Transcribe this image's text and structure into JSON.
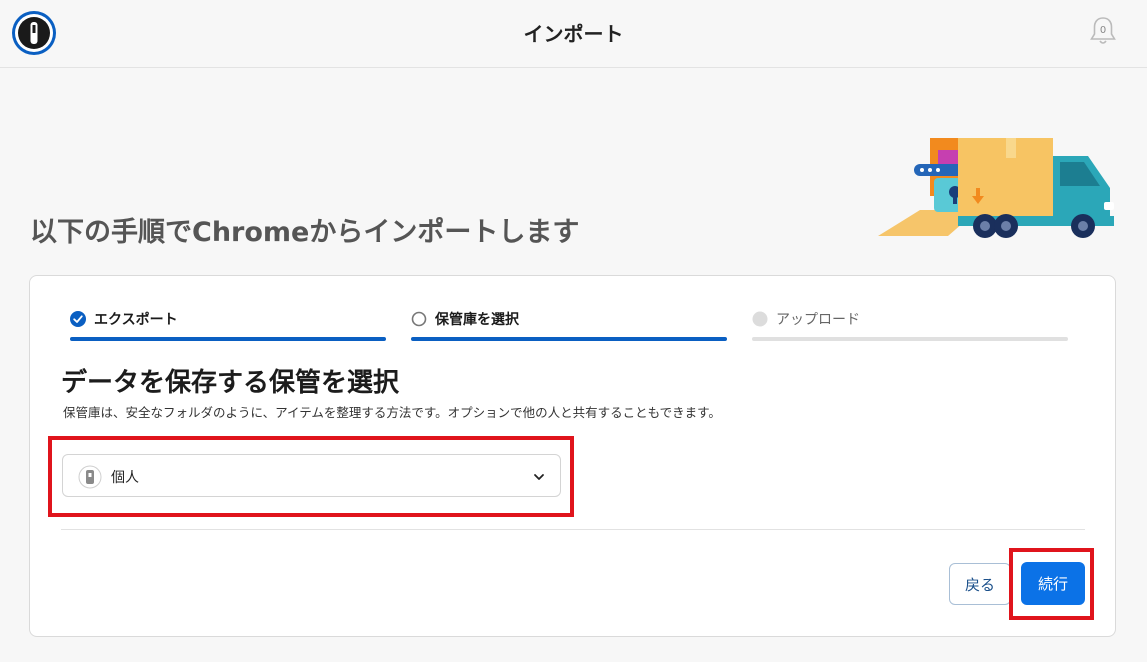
{
  "header": {
    "title": "インポート",
    "notification_count": "0"
  },
  "page": {
    "heading": "以下の手順でChromeからインポートします"
  },
  "steps": [
    {
      "label": "エクスポート",
      "state": "done"
    },
    {
      "label": "保管庫を選択",
      "state": "current"
    },
    {
      "label": "アップロード",
      "state": "upcoming"
    }
  ],
  "section": {
    "title": "データを保存する保管を選択",
    "description": "保管庫は、安全なフォルダのように、アイテムを整理する方法です。オプションで他の人と共有することもできます。"
  },
  "vault_select": {
    "selected": "個人"
  },
  "buttons": {
    "back": "戻る",
    "next": "続行"
  },
  "colors": {
    "accent": "#0b72e7",
    "step_active": "#0a5fc2",
    "step_inactive": "#e0e0e0",
    "highlight": "#e0141c"
  }
}
